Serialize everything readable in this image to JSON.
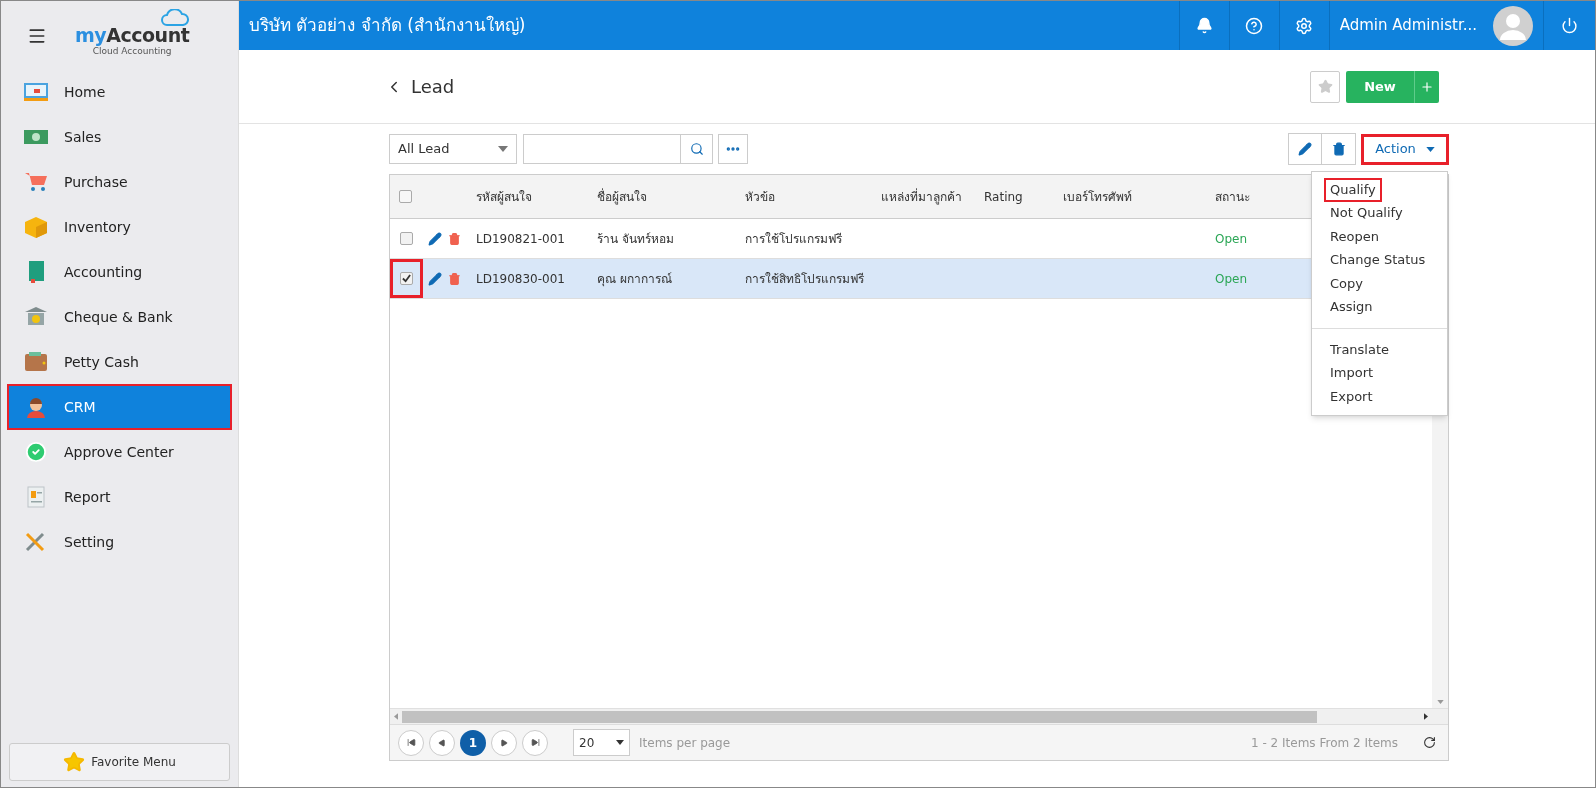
{
  "sidebar": {
    "logo": {
      "name": "myAccount",
      "tagline": "Cloud Accounting"
    },
    "items": [
      {
        "label": "Home",
        "kind": "home",
        "selected": false,
        "highlighted": false
      },
      {
        "label": "Sales",
        "kind": "sales",
        "selected": false,
        "highlighted": false
      },
      {
        "label": "Purchase",
        "kind": "purchase",
        "selected": false,
        "highlighted": false
      },
      {
        "label": "Inventory",
        "kind": "inventory",
        "selected": false,
        "highlighted": false
      },
      {
        "label": "Accounting",
        "kind": "accounting",
        "selected": false,
        "highlighted": false
      },
      {
        "label": "Cheque & Bank",
        "kind": "bank",
        "selected": false,
        "highlighted": false
      },
      {
        "label": "Petty Cash",
        "kind": "wallet",
        "selected": false,
        "highlighted": false
      },
      {
        "label": "CRM",
        "kind": "crm",
        "selected": true,
        "highlighted": true
      },
      {
        "label": "Approve Center",
        "kind": "approve",
        "selected": false,
        "highlighted": false
      },
      {
        "label": "Report",
        "kind": "report",
        "selected": false,
        "highlighted": false
      },
      {
        "label": "Setting",
        "kind": "setting",
        "selected": false,
        "highlighted": false
      }
    ],
    "favorite": "Favorite Menu"
  },
  "topbar": {
    "company": "บริษัท ตัวอย่าง จำกัด (สำนักงานใหญ่)",
    "user": "Admin Administr..."
  },
  "page": {
    "title": "Lead",
    "new_button": "New"
  },
  "toolbar": {
    "filter": "All Lead",
    "action_button": {
      "label": "Action",
      "highlighted": true
    }
  },
  "table": {
    "select_all_checked": false,
    "columns": [
      "รหัสผู้สนใจ",
      "ชื่อผู้สนใจ",
      "หัวข้อ",
      "แหล่งที่มาลูกค้า",
      "Rating",
      "เบอร์โทรศัพท์",
      "สถานะ"
    ],
    "rows": [
      {
        "selected": false,
        "highlighted": false,
        "cells": [
          "LD190821-001",
          "ร้าน จันทร์หอม",
          "การใช้โปรแกรมฟรี",
          "",
          "",
          "",
          "Open"
        ]
      },
      {
        "selected": true,
        "highlighted": true,
        "cells": [
          "LD190830-001",
          "คุณ ผกาการณ์",
          "การใช้สิทธิโปรแกรมฟรี",
          "",
          "",
          "",
          "Open"
        ]
      }
    ]
  },
  "action_menu": {
    "sections": [
      {
        "items": [
          {
            "label": "Qualify",
            "highlighted": true
          },
          {
            "label": "Not Qualify",
            "highlighted": false
          },
          {
            "label": "Reopen",
            "highlighted": false
          },
          {
            "label": "Change Status",
            "highlighted": false
          },
          {
            "label": "Copy",
            "highlighted": false
          },
          {
            "label": "Assign",
            "highlighted": false
          }
        ]
      },
      {
        "items": [
          {
            "label": "Translate",
            "highlighted": false
          },
          {
            "label": "Import",
            "highlighted": false
          },
          {
            "label": "Export",
            "highlighted": false
          }
        ]
      }
    ]
  },
  "pager": {
    "current": "1",
    "page_size": "20",
    "per_page_label": "Items per page",
    "summary": "1 - 2 Items From 2 Items"
  }
}
